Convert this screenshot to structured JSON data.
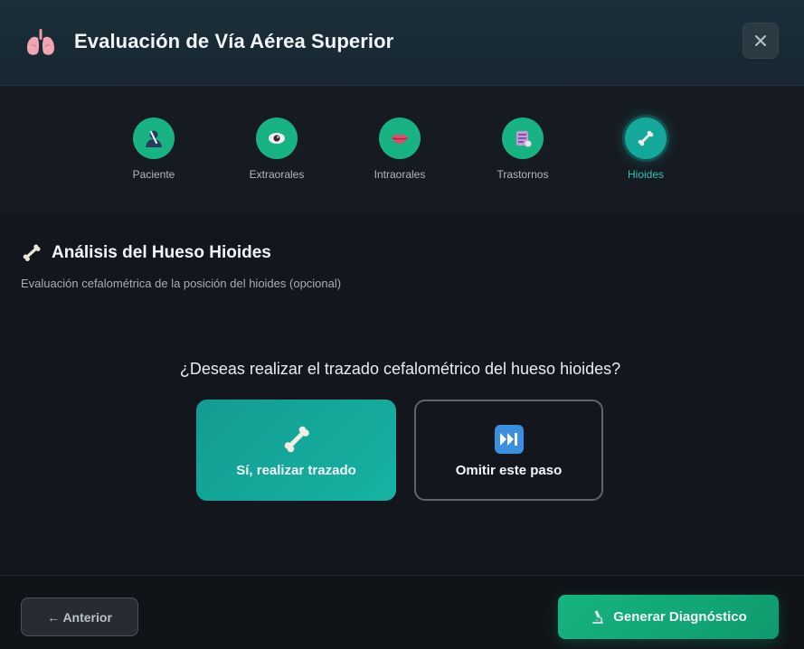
{
  "header": {
    "title": "Evaluación de Vía Aérea Superior",
    "logo_icon": "lungs-icon",
    "close_icon": "close-icon"
  },
  "stepper": {
    "steps": [
      {
        "label": "Paciente",
        "icon": "patient-icon",
        "state": "completed"
      },
      {
        "label": "Extraorales",
        "icon": "eye-icon",
        "state": "completed"
      },
      {
        "label": "Intraorales",
        "icon": "lips-icon",
        "state": "completed"
      },
      {
        "label": "Trastornos",
        "icon": "disorders-icon",
        "state": "completed"
      },
      {
        "label": "Hioides",
        "icon": "bone-icon",
        "state": "active"
      }
    ]
  },
  "section": {
    "title": "Análisis del Hueso Hioides",
    "subtitle": "Evaluación cefalométrica de la posición del hioides (opcional)",
    "question": "¿Deseas realizar el trazado cefalométrico del hueso hioides?"
  },
  "options": {
    "yes_label": "Sí, realizar trazado",
    "skip_label": "Omitir este paso"
  },
  "footer": {
    "prev_label": "← Anterior",
    "generate_label": "Generar Diagnóstico"
  },
  "colors": {
    "accent_teal": "#14a89a",
    "accent_green": "#18b382",
    "background": "#13171d"
  }
}
